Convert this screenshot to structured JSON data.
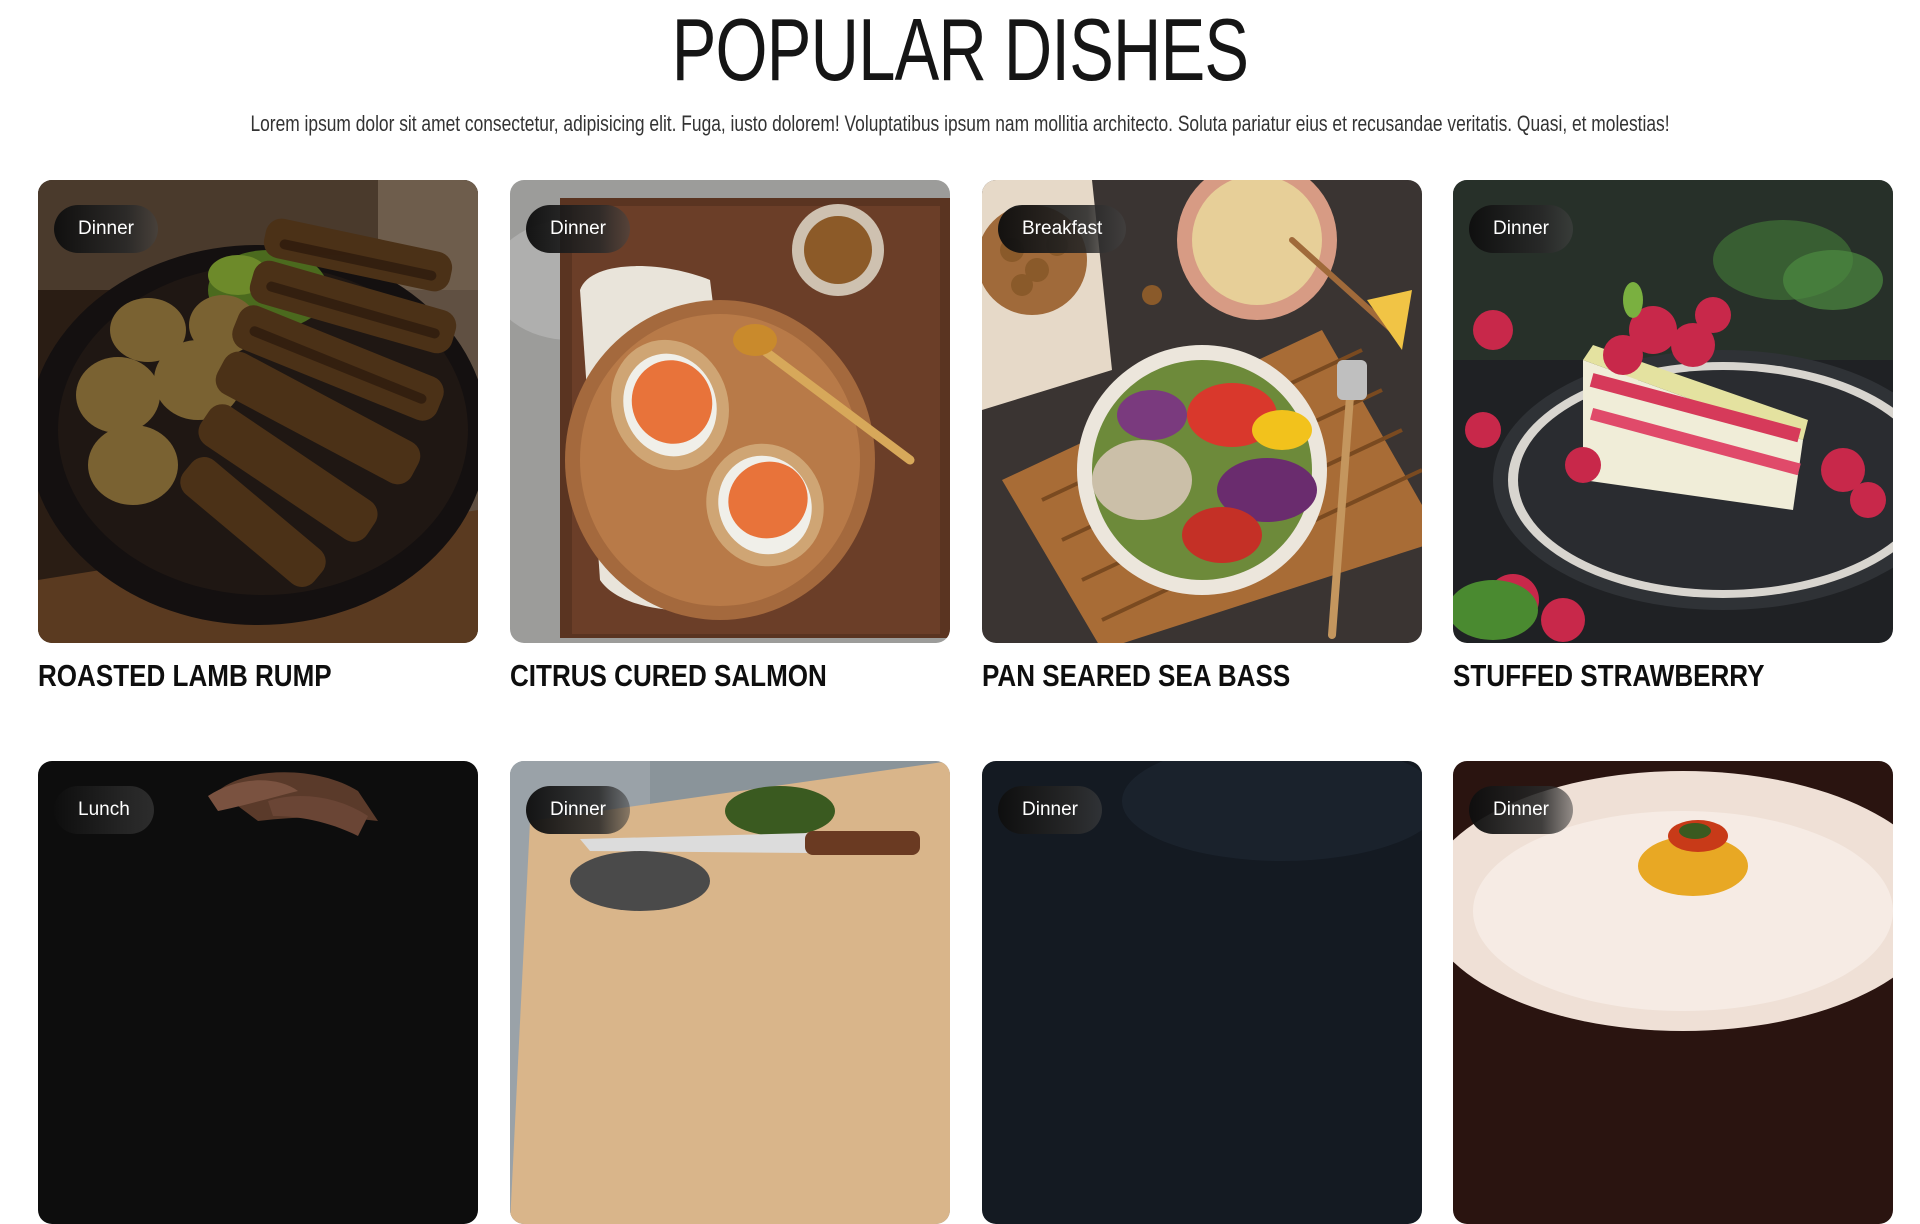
{
  "section": {
    "title": "POPULAR DISHES",
    "subtitle": "Lorem ipsum dolor sit amet consectetur, adipisicing elit. Fuga, iusto dolorem! Voluptatibus ipsum nam mollitia architecto. Soluta pariatur eius et recusandae veritatis. Quasi, et molestias!"
  },
  "dishes": [
    {
      "category": "Dinner",
      "name": "ROASTED LAMB RUMP",
      "image": "lamb-rump-with-potatoes-photo"
    },
    {
      "category": "Dinner",
      "name": "CITRUS CURED SALMON",
      "image": "salmon-toast-on-board-photo"
    },
    {
      "category": "Breakfast",
      "name": "PAN SEARED SEA BASS",
      "image": "salad-bowl-photo"
    },
    {
      "category": "Dinner",
      "name": "STUFFED STRAWBERRY",
      "image": "raspberry-cake-slice-photo"
    },
    {
      "category": "Lunch",
      "name": "",
      "image": "hand-over-dark-table-photo"
    },
    {
      "category": "Dinner",
      "name": "",
      "image": "cutting-board-with-knife-photo"
    },
    {
      "category": "Dinner",
      "name": "",
      "image": "dark-slate-background-photo"
    },
    {
      "category": "Dinner",
      "name": "",
      "image": "plated-dessert-photo"
    }
  ],
  "colors": {
    "badge_bg": "#1a1a1a",
    "badge_text": "#ffffff",
    "title_text": "#151515",
    "body_text": "#333333"
  }
}
